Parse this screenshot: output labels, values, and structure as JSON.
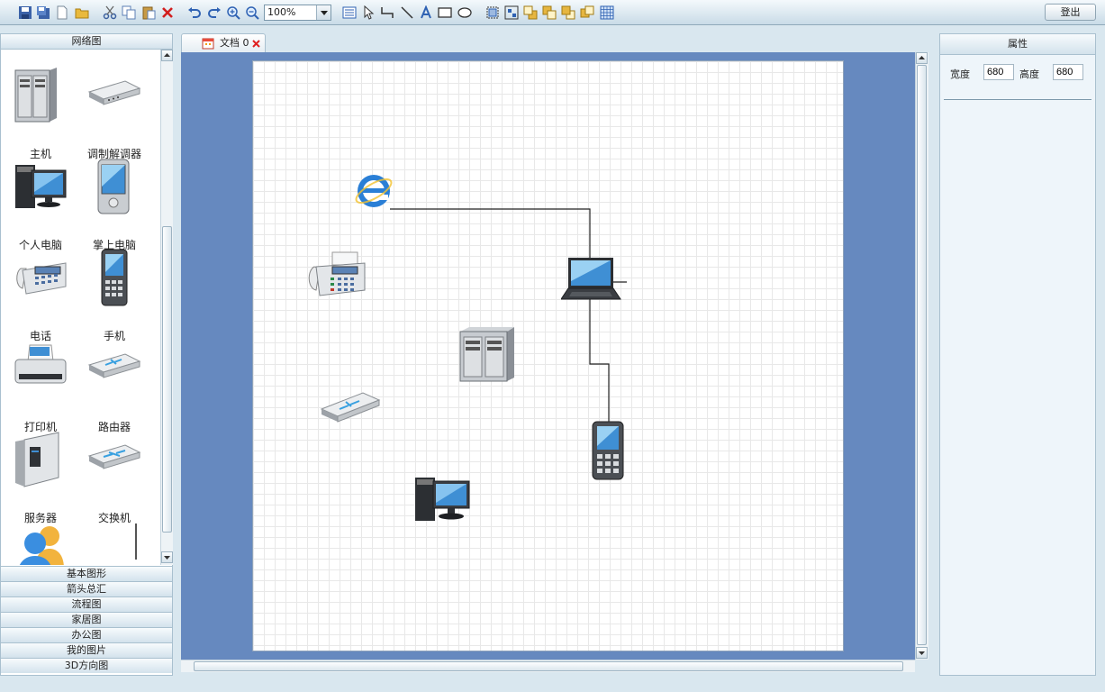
{
  "toolbar": {
    "zoom_value": "100%",
    "logout_label": "登出"
  },
  "left_panel": {
    "header": "网络图",
    "palette": [
      {
        "label": "主机",
        "icon": "host-icon"
      },
      {
        "label": "调制解调器",
        "icon": "modem-icon"
      },
      {
        "label": "个人电脑",
        "icon": "pc-icon"
      },
      {
        "label": "掌上电脑",
        "icon": "pda-icon"
      },
      {
        "label": "电话",
        "icon": "telephone-icon"
      },
      {
        "label": "手机",
        "icon": "mobile-phone-icon"
      },
      {
        "label": "打印机",
        "icon": "printer-icon"
      },
      {
        "label": "路由器",
        "icon": "router-icon"
      },
      {
        "label": "服务器",
        "icon": "server-icon"
      },
      {
        "label": "交换机",
        "icon": "switch-icon"
      }
    ],
    "categories": [
      "基本图形",
      "箭头总汇",
      "流程图",
      "家居图",
      "办公图",
      "我的图片",
      "3D方向图"
    ]
  },
  "document_tab": {
    "title": "文档 0"
  },
  "properties": {
    "header": "属性",
    "width_label": "宽度",
    "width_value": "680",
    "height_label": "高度",
    "height_value": "680"
  },
  "diagram_shapes": [
    "internet-explorer-icon",
    "fax-icon",
    "laptop-icon",
    "server-icon",
    "router-icon",
    "mobile-phone-icon",
    "pc-icon"
  ],
  "colors": {
    "canvas_background": "#6689bf",
    "panel_background": "#eef5fa"
  }
}
